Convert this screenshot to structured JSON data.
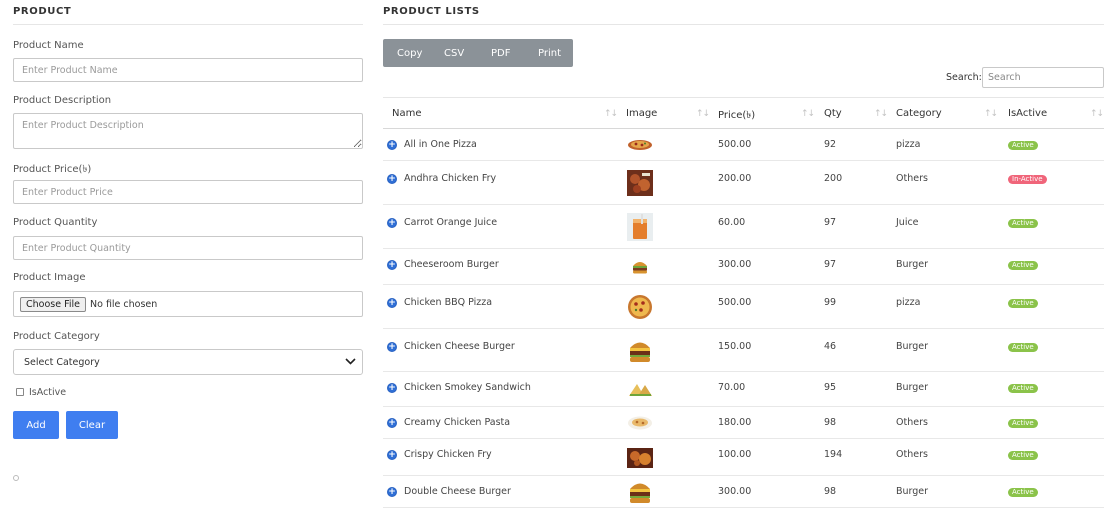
{
  "form": {
    "heading": "PRODUCT",
    "name_label": "Product Name",
    "name_placeholder": "Enter Product Name",
    "desc_label": "Product Description",
    "desc_placeholder": "Enter Product Description",
    "price_label": "Product Price(৳)",
    "price_placeholder": "Enter Product Price",
    "qty_label": "Product Quantity",
    "qty_placeholder": "Enter Product Quantity",
    "image_label": "Product Image",
    "file_button": "Choose File",
    "file_status": "No file chosen",
    "category_label": "Product Category",
    "category_selected": "Select Category",
    "isactive_label": "IsActive",
    "add_label": "Add",
    "clear_label": "Clear"
  },
  "list": {
    "heading": "PRODUCT LISTS",
    "export": [
      "Copy",
      "CSV",
      "PDF",
      "Print"
    ],
    "search_label": "Search:",
    "search_placeholder": "Search",
    "columns": [
      "Name",
      "Image",
      "Price(৳)",
      "Qty",
      "Category",
      "IsActive"
    ],
    "rows": [
      {
        "name": "All in One Pizza",
        "image": "pizza",
        "price": "500.00",
        "qty": "92",
        "category": "pizza",
        "status": "Active"
      },
      {
        "name": "Andhra Chicken Fry",
        "image": "chicken-fry",
        "price": "200.00",
        "qty": "200",
        "category": "Others",
        "status": "In-Active"
      },
      {
        "name": "Carrot Orange Juice",
        "image": "juice",
        "price": "60.00",
        "qty": "97",
        "category": "Juice",
        "status": "Active"
      },
      {
        "name": "Cheeseroom Burger",
        "image": "burger-small",
        "price": "300.00",
        "qty": "97",
        "category": "Burger",
        "status": "Active"
      },
      {
        "name": "Chicken BBQ Pizza",
        "image": "pizza-round",
        "price": "500.00",
        "qty": "99",
        "category": "pizza",
        "status": "Active"
      },
      {
        "name": "Chicken Cheese Burger",
        "image": "burger-tall",
        "price": "150.00",
        "qty": "46",
        "category": "Burger",
        "status": "Active"
      },
      {
        "name": "Chicken Smokey Sandwich",
        "image": "sandwich",
        "price": "70.00",
        "qty": "95",
        "category": "Burger",
        "status": "Active"
      },
      {
        "name": "Creamy Chicken Pasta",
        "image": "pasta",
        "price": "180.00",
        "qty": "98",
        "category": "Others",
        "status": "Active"
      },
      {
        "name": "Crispy Chicken Fry",
        "image": "crispy-fry",
        "price": "100.00",
        "qty": "194",
        "category": "Others",
        "status": "Active"
      },
      {
        "name": "Double Cheese Burger",
        "image": "burger-tall",
        "price": "300.00",
        "qty": "98",
        "category": "Burger",
        "status": "Active"
      }
    ]
  },
  "colors": {
    "primary": "#3f7ef0",
    "export_bar": "#8b9298",
    "active_badge": "#8bc34a",
    "inactive_badge": "#f0657a"
  }
}
